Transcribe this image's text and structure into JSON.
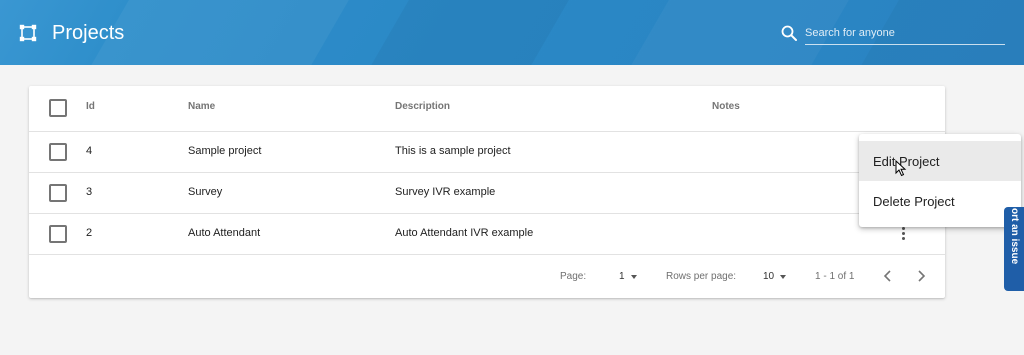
{
  "app": {
    "title": "Projects"
  },
  "icons": {
    "logo": "project-nodes-icon",
    "search": "search-icon",
    "row_menu": "more-vertical-icon",
    "prev": "chevron-left-icon",
    "next": "chevron-right-icon"
  },
  "colors": {
    "header": "#2a88c6",
    "report_tab": "#1f5ea8",
    "menu_hover": "#eaeaea"
  },
  "search": {
    "placeholder": "Search for anyone",
    "value": ""
  },
  "table": {
    "columns": {
      "id": "Id",
      "name": "Name",
      "description": "Description",
      "notes": "Notes"
    },
    "rows": [
      {
        "id": "4",
        "name": "Sample project",
        "description": "This is a sample project",
        "notes": ""
      },
      {
        "id": "3",
        "name": "Survey",
        "description": "Survey IVR example",
        "notes": ""
      },
      {
        "id": "2",
        "name": "Auto Attendant",
        "description": "Auto Attendant IVR example",
        "notes": ""
      }
    ]
  },
  "pagination": {
    "page_label": "Page:",
    "page_value": "1",
    "rows_label": "Rows per page:",
    "rows_value": "10",
    "range": "1 - 1 of 1"
  },
  "context_menu": {
    "items": [
      "Edit Project",
      "Delete Project"
    ],
    "hovered": "Edit Project"
  },
  "report_tab": {
    "label": "ort an issue"
  }
}
